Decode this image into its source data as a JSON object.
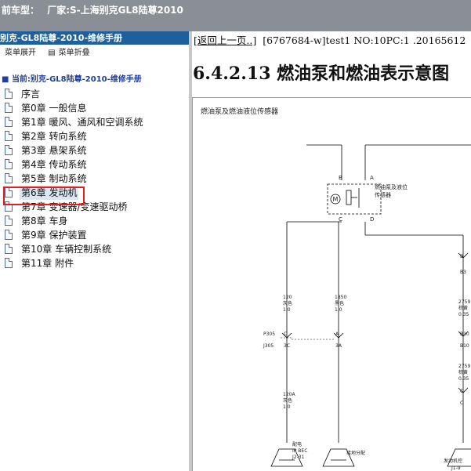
{
  "topbar": {
    "vehicle_label": "前车型：",
    "maker_label": "厂家:",
    "vehicle_value": "S-上海别克GL8陆尊2010"
  },
  "sidebar": {
    "header": "别克-GL8陆尊-2010-维修手册",
    "expand_label": "菜单展开",
    "collapse_label": "菜单折叠",
    "root": "当前:别克-GL8陆尊-2010-维修手册",
    "items": [
      "序言",
      "第0章 一般信息",
      "第1章 暖风、通风和空调系统",
      "第2章 转向系统",
      "第3章 悬架系统",
      "第4章 传动系统",
      "第5章 制动系统",
      "第6章 发动机",
      "第7章 变速器/变速驱动桥",
      "第8章 车身",
      "第9章 保护装置",
      "第10章 车辆控制系统",
      "第11章 附件"
    ],
    "selected_index": 7
  },
  "content": {
    "back_link": "[返回上一页..]",
    "doc_info": "[6767684-w]test1 NO:10PC:1 .20165612",
    "heading": "6.4.2.13 燃油泵和燃油表示意图"
  },
  "diagram": {
    "title": "燃油泵及燃油液位传感器",
    "component_label": [
      "燃油泵及液位",
      "传感器"
    ],
    "pins": {
      "top_left": "B",
      "top_right": "A",
      "bottom_left": "C",
      "bottom_right": "D"
    },
    "motor_symbol": "M",
    "wire_left": [
      "120",
      "灰色",
      "1.0"
    ],
    "wire_mid": [
      "1850",
      "黑色",
      "1.0"
    ],
    "wire_right": [
      "2759",
      "棕黄",
      "0.35"
    ],
    "wire_right2": [
      "2759",
      "棕黄",
      "0.35"
    ],
    "wire_bottom": [
      "120A",
      "灰色",
      "1.0"
    ],
    "connector_p305": "P305",
    "connector_j305": "J305",
    "pin_c": "C",
    "pin_3c": "3C",
    "pin_a": "A",
    "pin_3a": "3A",
    "pin_b": "B",
    "pin_b3": "B3",
    "pin_b10": "B10",
    "pin_b10b": "B10",
    "pin_c2": "C",
    "pin_c3": "C",
    "ground_left": [
      "配电",
      "IP BEC",
      "J2-31"
    ],
    "ground_mid": "接地分配",
    "ground_right": [
      "发动机控",
      "J1-9"
    ]
  }
}
